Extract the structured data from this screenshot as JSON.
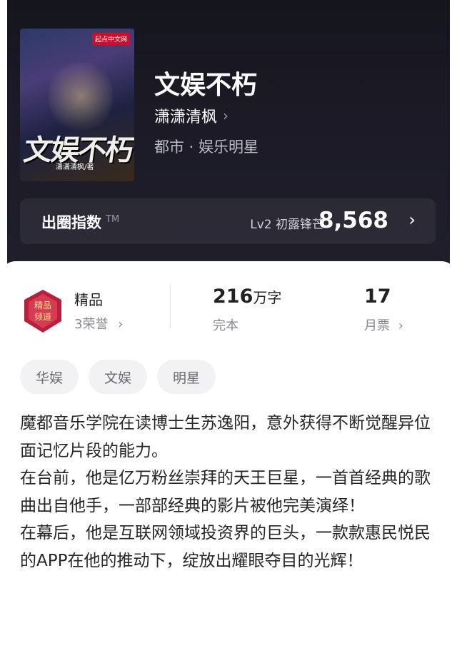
{
  "book": {
    "title": "文娱不朽",
    "author": "潇潇清枫",
    "genre": "都市 · 娱乐明星",
    "cover": {
      "logo_text": "起点中文网",
      "title_text": "文娱不朽",
      "author_text": "潇潇清枫/著"
    }
  },
  "index": {
    "label": "出圈指数",
    "tm": "TM",
    "level": "Lv2 初露锋芒",
    "score": "8,568"
  },
  "stats": {
    "quality_label": "精品",
    "honors": "3荣誉",
    "words_value": "216",
    "words_unit": "万字",
    "status": "完本",
    "votes_value": "17",
    "votes_label": "月票"
  },
  "tags": [
    "华娱",
    "文娱",
    "明星"
  ],
  "description": [
    "魔都音乐学院在读博士生苏逸阳，意外获得不断觉醒异位面记忆片段的能力。",
    "在台前，他是亿万粉丝崇拜的天王巨星，一首首经典的歌曲出自他手，一部部经典的影片被他完美演绎！",
    "在幕后，他是互联网领域投资界的巨头，一款款惠民悦民的APP在他的推动下，绽放出耀眼夺目的光辉！"
  ],
  "icons": {
    "chevron": "chevron-right-icon",
    "badge": "quality-badge-icon"
  },
  "colors": {
    "hero_bg": "#1b1a26",
    "badge_red": "#b8203a"
  }
}
